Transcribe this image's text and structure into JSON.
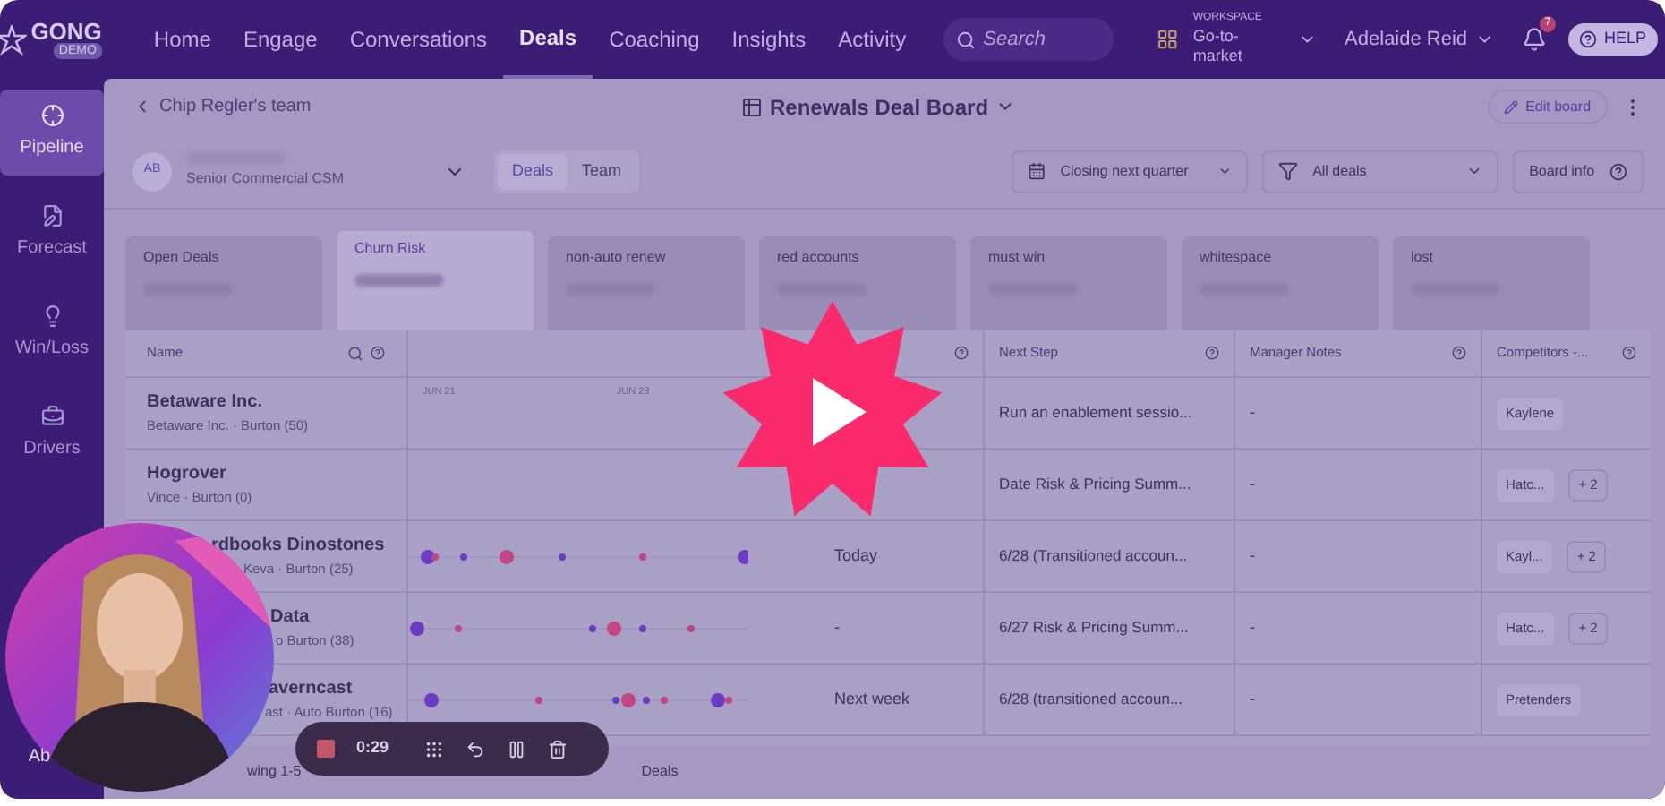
{
  "nav": {
    "logo": "GONG",
    "logo_badge": "DEMO",
    "items": [
      {
        "label": "Home",
        "selected": false
      },
      {
        "label": "Engage",
        "selected": false
      },
      {
        "label": "Conversations",
        "selected": false
      },
      {
        "label": "Deals",
        "selected": true
      },
      {
        "label": "Coaching",
        "selected": false
      },
      {
        "label": "Insights",
        "selected": false
      },
      {
        "label": "Activity",
        "selected": false
      }
    ],
    "search": {
      "placeholder": "Search"
    },
    "workspace": {
      "label": "WORKSPACE",
      "value": "Go-to-market"
    },
    "user": "Adelaide Reid",
    "notification_count": "7",
    "help": "HELP"
  },
  "sidebar": {
    "items": [
      {
        "label": "Pipeline",
        "kind": "pipeline",
        "selected": true
      },
      {
        "label": "Forecast",
        "kind": "forecast",
        "selected": false
      },
      {
        "label": "Win/Loss",
        "kind": "winloss",
        "selected": false
      },
      {
        "label": "Drivers",
        "kind": "drivers",
        "selected": false
      }
    ],
    "footer": "Ab"
  },
  "board": {
    "back": "Chip Regler's team",
    "title": "Renewals Deal Board",
    "edit": "Edit board"
  },
  "owner": {
    "initials": "AB",
    "role": "Senior Commercial CSM"
  },
  "view_tabs": [
    {
      "label": "Deals",
      "selected": true
    },
    {
      "label": "Team",
      "selected": false
    }
  ],
  "filters": [
    {
      "label": "Closing next quarter",
      "kind": "calendar"
    },
    {
      "label": "All deals",
      "kind": "filter"
    }
  ],
  "board_info": "Board info",
  "cards": [
    {
      "label": "Open Deals",
      "selected": false
    },
    {
      "label": "Churn Risk",
      "selected": true
    },
    {
      "label": "non-auto renew",
      "selected": false
    },
    {
      "label": "red accounts",
      "selected": false
    },
    {
      "label": "must win",
      "selected": false
    },
    {
      "label": "whitespace",
      "selected": false
    },
    {
      "label": "lost",
      "selected": false
    }
  ],
  "table": {
    "columns": {
      "name": "Name",
      "next_step": "Next Step",
      "notes": "Manager Notes",
      "competitors": "Competitors -..."
    },
    "timeline_labels": [
      "JUN 21",
      "JUN 28"
    ],
    "rows": [
      {
        "name": "Betaware Inc.",
        "subtitle": "Betaware Inc. · Burton (50)",
        "next_step": "Run an enablement sessio...",
        "notes": "-",
        "competitors": [
          "Kaylene"
        ]
      },
      {
        "name": "Hogrover",
        "subtitle": "Vince · Burton (0)",
        "next_step": "Date Risk & Pricing Summ...",
        "notes": "-",
        "competitors": [
          "Hatc...",
          "+ 2"
        ]
      },
      {
        "name": "rdbooks Dinostones",
        "subtitle": "Keva · Burton (25)",
        "due": "Today",
        "next_step": "6/28 (Transitioned accoun...",
        "notes": "-",
        "competitors": [
          "Kayl...",
          "+ 2"
        ]
      },
      {
        "name": "Data",
        "subtitle": "o Burton (38)",
        "due": "-",
        "next_step": "6/27 Risk & Pricing Summ...",
        "notes": "-",
        "competitors": [
          "Hatc...",
          "+ 2"
        ]
      },
      {
        "name": "averncast",
        "subtitle": "ast · Auto Burton (16)",
        "due": "Next week",
        "next_step": "6/28 (transitioned accoun...",
        "notes": "-",
        "competitors": [
          "Pretenders"
        ]
      }
    ]
  },
  "footer": {
    "showing": "wing 1-5",
    "tab": "Deals"
  },
  "recording": {
    "time": "0:29"
  }
}
